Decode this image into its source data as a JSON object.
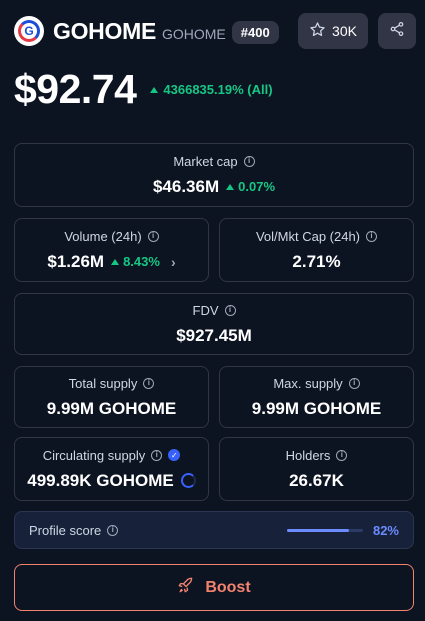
{
  "header": {
    "logo_letter": "G",
    "name": "GOHOME",
    "symbol": "GOHOME",
    "rank": "#400",
    "watchlist_count": "30K"
  },
  "price": {
    "value": "$92.74",
    "change": "4366835.19% (All)",
    "direction": "up"
  },
  "stats": {
    "market_cap": {
      "label": "Market cap",
      "value": "$46.36M",
      "change": "0.07%"
    },
    "volume": {
      "label": "Volume (24h)",
      "value": "$1.26M",
      "change": "8.43%"
    },
    "vol_mkt_cap": {
      "label": "Vol/Mkt Cap (24h)",
      "value": "2.71%"
    },
    "fdv": {
      "label": "FDV",
      "value": "$927.45M"
    },
    "total_supply": {
      "label": "Total supply",
      "value": "9.99M GOHOME"
    },
    "max_supply": {
      "label": "Max. supply",
      "value": "9.99M GOHOME"
    },
    "circulating_supply": {
      "label": "Circulating supply",
      "value": "499.89K GOHOME"
    },
    "holders": {
      "label": "Holders",
      "value": "26.67K"
    }
  },
  "profile": {
    "label": "Profile score",
    "score": "82%",
    "score_fraction": 0.82
  },
  "boost": {
    "label": "Boost"
  },
  "colors": {
    "background": "#0d1421",
    "positive": "#16c784",
    "accent": "#3861fb",
    "boost": "#f3826f"
  },
  "icons": {
    "logo": "gohome-logo",
    "watch": "star-icon",
    "share": "share-icon",
    "info": "info-icon",
    "verified": "verified-badge-icon",
    "boost": "rocket-icon"
  }
}
